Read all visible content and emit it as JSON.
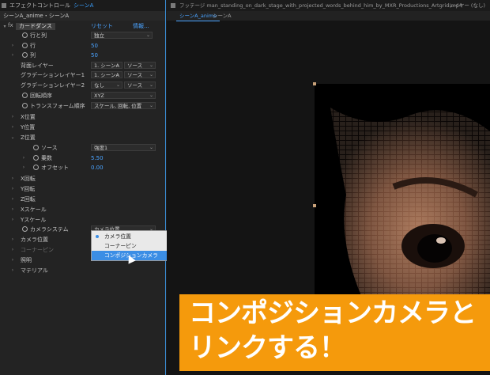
{
  "effects_panel": {
    "tab_title": "エフェクトコントロール",
    "tab_comp": "シーンA",
    "breadcrumb": "シーンA_anime・シーンA",
    "effect_name": "カードダンス",
    "reset_label": "リセット",
    "info_label": "情報..."
  },
  "props": {
    "rows_cols": {
      "label": "行と列",
      "value": "独立"
    },
    "rows": {
      "label": "行",
      "value": "50"
    },
    "cols": {
      "label": "列",
      "value": "50"
    },
    "back_layer": {
      "label": "背面レイヤー",
      "value": "1. シーンA",
      "source": "ソース"
    },
    "grad1": {
      "label": "グラデーションレイヤー1",
      "value": "1. シーンA",
      "source": "ソース"
    },
    "grad2": {
      "label": "グラデーションレイヤー2",
      "value": "なし",
      "source": "ソース"
    },
    "rot_order": {
      "label": "回転順序",
      "value": "XYZ"
    },
    "transform_order": {
      "label": "トランスフォーム順序",
      "value": "スケール, 回転, 位置"
    },
    "x_pos": {
      "label": "X位置"
    },
    "y_pos": {
      "label": "Y位置"
    },
    "z_pos": {
      "label": "Z位置"
    },
    "source": {
      "label": "ソース",
      "value": "強度1"
    },
    "multiplier": {
      "label": "乗数",
      "value": "5.50"
    },
    "offset": {
      "label": "オフセット",
      "value": "0.00"
    },
    "x_rot": {
      "label": "X回転"
    },
    "y_rot": {
      "label": "Y回転"
    },
    "z_rot": {
      "label": "Z回転"
    },
    "x_scale": {
      "label": "Xスケール"
    },
    "y_scale": {
      "label": "Yスケール"
    },
    "camera_system": {
      "label": "カメラシステム",
      "value": "カメラ位置"
    },
    "camera_pos": {
      "label": "カメラ位置"
    },
    "corner_pin": {
      "label": "コーナーピン"
    },
    "lighting": {
      "label": "照明"
    },
    "material": {
      "label": "マテリアル"
    }
  },
  "popup": {
    "options": [
      "カメラ位置",
      "コーナーピン",
      "コンポジションカメラ"
    ],
    "checked_index": 0,
    "highlighted_index": 2
  },
  "viewer": {
    "footage_tab": "フッテージ man_standing_on_dark_stage_with_projected_words_behind_him_by_MXR_Productions_Artgrid.mp4",
    "layer_label": "レイヤー (なし)",
    "comp_tab": "シーンA_anime",
    "comp_tab2": "シーンA"
  },
  "caption": {
    "line1": "コンポジションカメラと",
    "line2": "リンクする！"
  },
  "colors": {
    "accent": "#3a8fd8",
    "caption_bg": "#f59a0c"
  },
  "icons": [
    "stopwatch-icon",
    "disclosure-triangle-icon",
    "dropdown-arrow-icon"
  ]
}
